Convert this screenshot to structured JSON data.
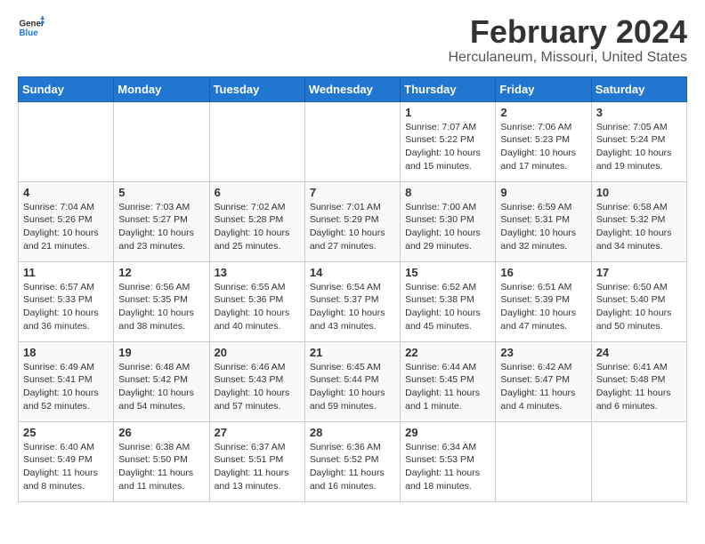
{
  "header": {
    "logo_general": "General",
    "logo_blue": "Blue",
    "title": "February 2024",
    "subtitle": "Herculaneum, Missouri, United States"
  },
  "weekdays": [
    "Sunday",
    "Monday",
    "Tuesday",
    "Wednesday",
    "Thursday",
    "Friday",
    "Saturday"
  ],
  "weeks": [
    [
      {
        "day": "",
        "info": ""
      },
      {
        "day": "",
        "info": ""
      },
      {
        "day": "",
        "info": ""
      },
      {
        "day": "",
        "info": ""
      },
      {
        "day": "1",
        "info": "Sunrise: 7:07 AM\nSunset: 5:22 PM\nDaylight: 10 hours\nand 15 minutes."
      },
      {
        "day": "2",
        "info": "Sunrise: 7:06 AM\nSunset: 5:23 PM\nDaylight: 10 hours\nand 17 minutes."
      },
      {
        "day": "3",
        "info": "Sunrise: 7:05 AM\nSunset: 5:24 PM\nDaylight: 10 hours\nand 19 minutes."
      }
    ],
    [
      {
        "day": "4",
        "info": "Sunrise: 7:04 AM\nSunset: 5:26 PM\nDaylight: 10 hours\nand 21 minutes."
      },
      {
        "day": "5",
        "info": "Sunrise: 7:03 AM\nSunset: 5:27 PM\nDaylight: 10 hours\nand 23 minutes."
      },
      {
        "day": "6",
        "info": "Sunrise: 7:02 AM\nSunset: 5:28 PM\nDaylight: 10 hours\nand 25 minutes."
      },
      {
        "day": "7",
        "info": "Sunrise: 7:01 AM\nSunset: 5:29 PM\nDaylight: 10 hours\nand 27 minutes."
      },
      {
        "day": "8",
        "info": "Sunrise: 7:00 AM\nSunset: 5:30 PM\nDaylight: 10 hours\nand 29 minutes."
      },
      {
        "day": "9",
        "info": "Sunrise: 6:59 AM\nSunset: 5:31 PM\nDaylight: 10 hours\nand 32 minutes."
      },
      {
        "day": "10",
        "info": "Sunrise: 6:58 AM\nSunset: 5:32 PM\nDaylight: 10 hours\nand 34 minutes."
      }
    ],
    [
      {
        "day": "11",
        "info": "Sunrise: 6:57 AM\nSunset: 5:33 PM\nDaylight: 10 hours\nand 36 minutes."
      },
      {
        "day": "12",
        "info": "Sunrise: 6:56 AM\nSunset: 5:35 PM\nDaylight: 10 hours\nand 38 minutes."
      },
      {
        "day": "13",
        "info": "Sunrise: 6:55 AM\nSunset: 5:36 PM\nDaylight: 10 hours\nand 40 minutes."
      },
      {
        "day": "14",
        "info": "Sunrise: 6:54 AM\nSunset: 5:37 PM\nDaylight: 10 hours\nand 43 minutes."
      },
      {
        "day": "15",
        "info": "Sunrise: 6:52 AM\nSunset: 5:38 PM\nDaylight: 10 hours\nand 45 minutes."
      },
      {
        "day": "16",
        "info": "Sunrise: 6:51 AM\nSunset: 5:39 PM\nDaylight: 10 hours\nand 47 minutes."
      },
      {
        "day": "17",
        "info": "Sunrise: 6:50 AM\nSunset: 5:40 PM\nDaylight: 10 hours\nand 50 minutes."
      }
    ],
    [
      {
        "day": "18",
        "info": "Sunrise: 6:49 AM\nSunset: 5:41 PM\nDaylight: 10 hours\nand 52 minutes."
      },
      {
        "day": "19",
        "info": "Sunrise: 6:48 AM\nSunset: 5:42 PM\nDaylight: 10 hours\nand 54 minutes."
      },
      {
        "day": "20",
        "info": "Sunrise: 6:46 AM\nSunset: 5:43 PM\nDaylight: 10 hours\nand 57 minutes."
      },
      {
        "day": "21",
        "info": "Sunrise: 6:45 AM\nSunset: 5:44 PM\nDaylight: 10 hours\nand 59 minutes."
      },
      {
        "day": "22",
        "info": "Sunrise: 6:44 AM\nSunset: 5:45 PM\nDaylight: 11 hours\nand 1 minute."
      },
      {
        "day": "23",
        "info": "Sunrise: 6:42 AM\nSunset: 5:47 PM\nDaylight: 11 hours\nand 4 minutes."
      },
      {
        "day": "24",
        "info": "Sunrise: 6:41 AM\nSunset: 5:48 PM\nDaylight: 11 hours\nand 6 minutes."
      }
    ],
    [
      {
        "day": "25",
        "info": "Sunrise: 6:40 AM\nSunset: 5:49 PM\nDaylight: 11 hours\nand 8 minutes."
      },
      {
        "day": "26",
        "info": "Sunrise: 6:38 AM\nSunset: 5:50 PM\nDaylight: 11 hours\nand 11 minutes."
      },
      {
        "day": "27",
        "info": "Sunrise: 6:37 AM\nSunset: 5:51 PM\nDaylight: 11 hours\nand 13 minutes."
      },
      {
        "day": "28",
        "info": "Sunrise: 6:36 AM\nSunset: 5:52 PM\nDaylight: 11 hours\nand 16 minutes."
      },
      {
        "day": "29",
        "info": "Sunrise: 6:34 AM\nSunset: 5:53 PM\nDaylight: 11 hours\nand 18 minutes."
      },
      {
        "day": "",
        "info": ""
      },
      {
        "day": "",
        "info": ""
      }
    ]
  ]
}
